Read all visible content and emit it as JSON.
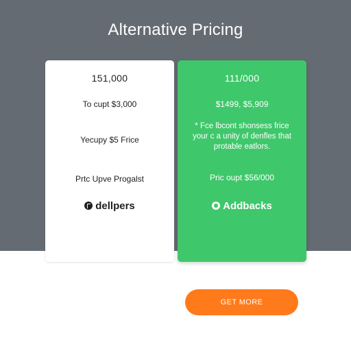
{
  "header": {
    "title": "Alternative Pricing"
  },
  "plans": {
    "left": {
      "price": "151,000",
      "line1": "To cupt $3,000",
      "line2": "Yecupy $5 Frice",
      "line3": "Prtc Upve Progalst",
      "feature": "dellpers"
    },
    "right": {
      "price": "111/000",
      "line1": "$1499, $5,909",
      "line2": "* Fce lbcont shonsess frice\nyour c a unity of denfles that\nprotable eatlors.",
      "line3": "Pric oupt $56/000",
      "feature": "Addbacks"
    }
  },
  "cta": {
    "label": "GET MORE"
  },
  "colors": {
    "background_top": "#656b72",
    "background_bottom": "#ffffff",
    "accent_green": "#3fc76b",
    "cta_orange": "#ff7a1a"
  }
}
